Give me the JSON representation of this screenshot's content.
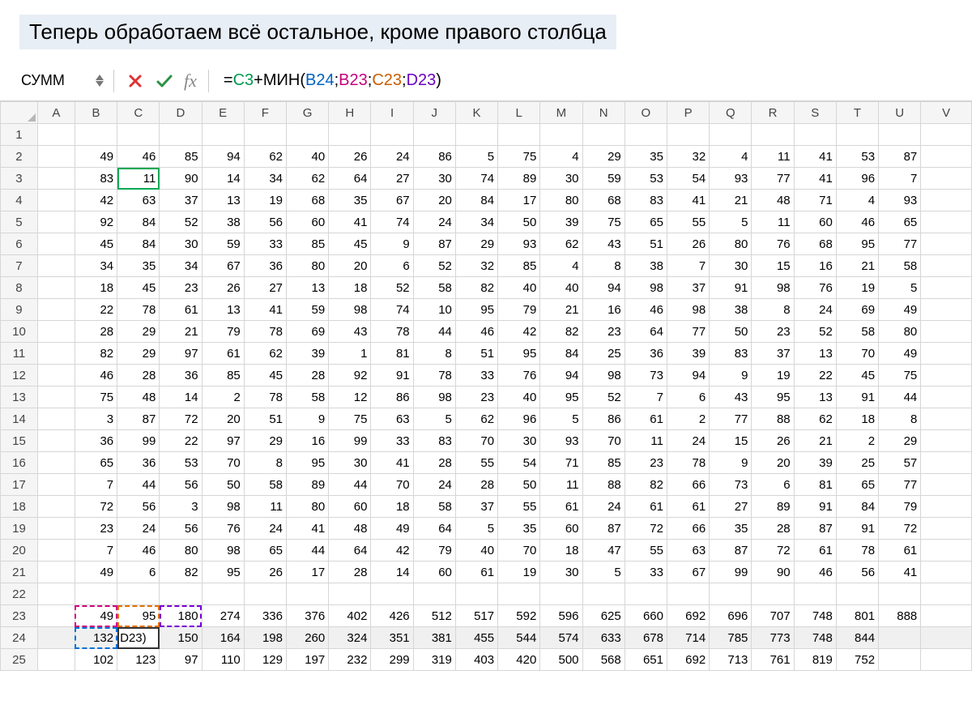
{
  "title": "Теперь обработаем всё остальное, кроме правого столбца",
  "name_box": "СУММ",
  "formula": {
    "prefix": "=",
    "ref_green": "C3",
    "plus": "+",
    "func": "МИН",
    "open": "(",
    "ref_blue": "B24",
    "sep": ";",
    "ref_pink": "B23",
    "ref_orange": "C23",
    "ref_purple": "D23",
    "close": ")"
  },
  "columns": [
    "A",
    "B",
    "C",
    "D",
    "E",
    "F",
    "G",
    "H",
    "I",
    "J",
    "K",
    "L",
    "M",
    "N",
    "O",
    "P",
    "Q",
    "R",
    "S",
    "T",
    "U",
    "V"
  ],
  "row_numbers": [
    1,
    2,
    3,
    4,
    5,
    6,
    7,
    8,
    9,
    10,
    11,
    12,
    13,
    14,
    15,
    16,
    17,
    18,
    19,
    20,
    21,
    22,
    23,
    24,
    25
  ],
  "edit_cell_text": "D23)",
  "grid": {
    "r2": [
      49,
      46,
      85,
      94,
      62,
      40,
      26,
      24,
      86,
      5,
      75,
      4,
      29,
      35,
      32,
      4,
      11,
      41,
      53,
      87
    ],
    "r3": [
      83,
      11,
      90,
      14,
      34,
      62,
      64,
      27,
      30,
      74,
      89,
      30,
      59,
      53,
      54,
      93,
      77,
      41,
      96,
      7
    ],
    "r4": [
      42,
      63,
      37,
      13,
      19,
      68,
      35,
      67,
      20,
      84,
      17,
      80,
      68,
      83,
      41,
      21,
      48,
      71,
      4,
      93
    ],
    "r5": [
      92,
      84,
      52,
      38,
      56,
      60,
      41,
      74,
      24,
      34,
      50,
      39,
      75,
      65,
      55,
      5,
      11,
      60,
      46,
      65
    ],
    "r6": [
      45,
      84,
      30,
      59,
      33,
      85,
      45,
      9,
      87,
      29,
      93,
      62,
      43,
      51,
      26,
      80,
      76,
      68,
      95,
      77
    ],
    "r7": [
      34,
      35,
      34,
      67,
      36,
      80,
      20,
      6,
      52,
      32,
      85,
      4,
      8,
      38,
      7,
      30,
      15,
      16,
      21,
      58
    ],
    "r8": [
      18,
      45,
      23,
      26,
      27,
      13,
      18,
      52,
      58,
      82,
      40,
      40,
      94,
      98,
      37,
      91,
      98,
      76,
      19,
      5
    ],
    "r9": [
      22,
      78,
      61,
      13,
      41,
      59,
      98,
      74,
      10,
      95,
      79,
      21,
      16,
      46,
      98,
      38,
      8,
      24,
      69,
      49
    ],
    "r10": [
      28,
      29,
      21,
      79,
      78,
      69,
      43,
      78,
      44,
      46,
      42,
      82,
      23,
      64,
      77,
      50,
      23,
      52,
      58,
      80
    ],
    "r11": [
      82,
      29,
      97,
      61,
      62,
      39,
      1,
      81,
      8,
      51,
      95,
      84,
      25,
      36,
      39,
      83,
      37,
      13,
      70,
      49
    ],
    "r12": [
      46,
      28,
      36,
      85,
      45,
      28,
      92,
      91,
      78,
      33,
      76,
      94,
      98,
      73,
      94,
      9,
      19,
      22,
      45,
      75
    ],
    "r13": [
      75,
      48,
      14,
      2,
      78,
      58,
      12,
      86,
      98,
      23,
      40,
      95,
      52,
      7,
      6,
      43,
      95,
      13,
      91,
      44
    ],
    "r14": [
      3,
      87,
      72,
      20,
      51,
      9,
      75,
      63,
      5,
      62,
      96,
      5,
      86,
      61,
      2,
      77,
      88,
      62,
      18,
      8
    ],
    "r15": [
      36,
      99,
      22,
      97,
      29,
      16,
      99,
      33,
      83,
      70,
      30,
      93,
      70,
      11,
      24,
      15,
      26,
      21,
      2,
      29
    ],
    "r16": [
      65,
      36,
      53,
      70,
      8,
      95,
      30,
      41,
      28,
      55,
      54,
      71,
      85,
      23,
      78,
      9,
      20,
      39,
      25,
      57
    ],
    "r17": [
      7,
      44,
      56,
      50,
      58,
      89,
      44,
      70,
      24,
      28,
      50,
      11,
      88,
      82,
      66,
      73,
      6,
      81,
      65,
      77
    ],
    "r18": [
      72,
      56,
      3,
      98,
      11,
      80,
      60,
      18,
      58,
      37,
      55,
      61,
      24,
      61,
      61,
      27,
      89,
      91,
      84,
      79
    ],
    "r19": [
      23,
      24,
      56,
      76,
      24,
      41,
      48,
      49,
      64,
      5,
      35,
      60,
      87,
      72,
      66,
      35,
      28,
      87,
      91,
      72
    ],
    "r20": [
      7,
      46,
      80,
      98,
      65,
      44,
      64,
      42,
      79,
      40,
      70,
      18,
      47,
      55,
      63,
      87,
      72,
      61,
      78,
      61
    ],
    "r21": [
      49,
      6,
      82,
      95,
      26,
      17,
      28,
      14,
      60,
      61,
      19,
      30,
      5,
      33,
      67,
      99,
      90,
      46,
      56,
      41
    ],
    "r23": [
      49,
      95,
      180,
      274,
      336,
      376,
      402,
      426,
      512,
      517,
      592,
      596,
      625,
      660,
      692,
      696,
      707,
      748,
      801,
      888
    ],
    "r24": [
      132,
      null,
      150,
      164,
      198,
      260,
      324,
      351,
      381,
      455,
      544,
      574,
      633,
      678,
      714,
      785,
      773,
      748,
      844,
      null
    ],
    "r25": [
      102,
      123,
      97,
      110,
      129,
      197,
      232,
      299,
      319,
      403,
      420,
      500,
      568,
      651,
      692,
      713,
      761,
      819,
      752,
      null
    ]
  }
}
